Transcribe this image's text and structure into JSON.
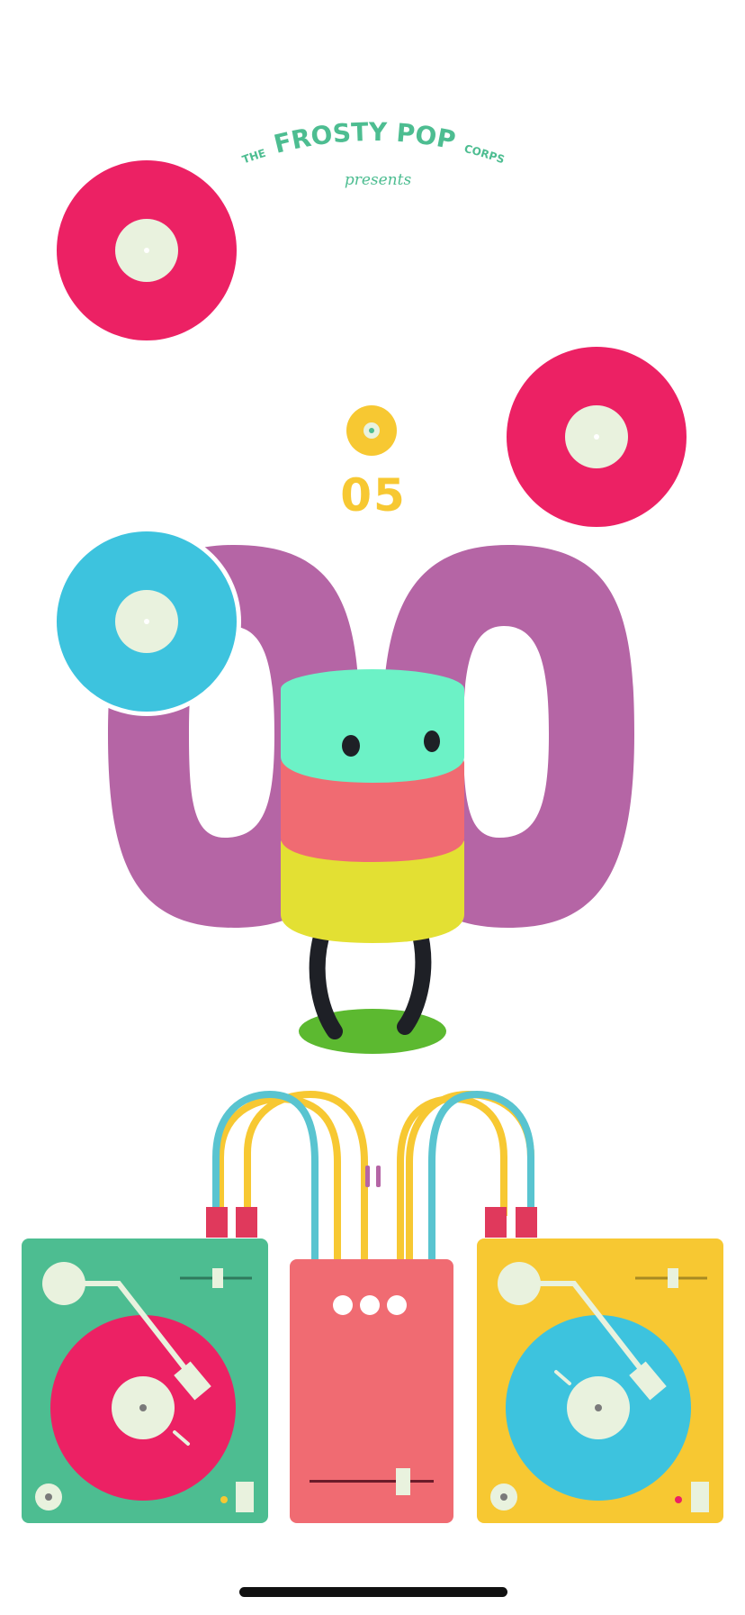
{
  "brand": {
    "the": "THE",
    "name": "FROSTY POP",
    "corps": "CORPS",
    "presents": "presents"
  },
  "score": "05",
  "big_number": "00",
  "colors": {
    "pink": "#ec2164",
    "blue": "#3dc3de",
    "purple": "#b565a5",
    "yellow": "#f7c832",
    "green_deck": "#4dbd91",
    "coral": "#f06b72",
    "mint": "#6cf2c6",
    "lime": "#e3e033",
    "grass": "#5cb930",
    "label_cream": "#e9f2de"
  },
  "icons": {
    "pause": "pause-icon",
    "coin": "coin-icon"
  }
}
